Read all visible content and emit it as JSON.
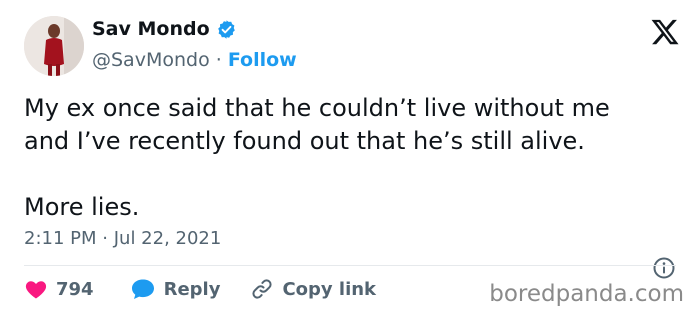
{
  "author": {
    "name": "Sav Mondo",
    "handle": "@SavMondo",
    "separator": "·",
    "follow_label": "Follow"
  },
  "tweet": {
    "text": "My ex once said that he couldn’t live without me\nand I’ve recently found out that he’s still alive.\n\nMore lies.",
    "time": "2:11 PM",
    "date_separator": "·",
    "date": "Jul 22, 2021"
  },
  "actions": {
    "likes_count": "794",
    "reply_label": "Reply",
    "copy_link_label": "Copy link"
  },
  "watermark": "boredpanda.com",
  "colors": {
    "accent": "#1d9bf0",
    "like": "#f91880",
    "text": "#0f1419",
    "muted": "#536471"
  },
  "icons": [
    "verified-badge-icon",
    "x-logo-icon",
    "info-icon",
    "heart-icon",
    "reply-bubble-icon",
    "link-icon"
  ]
}
